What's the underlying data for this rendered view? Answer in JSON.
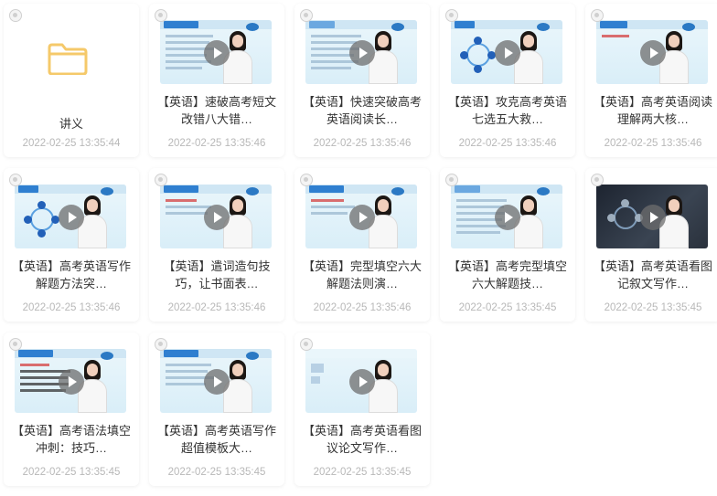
{
  "items": [
    {
      "title": "讲义",
      "date": "2022-02-25 13:35:44",
      "type": "folder"
    },
    {
      "title": "【英语】速破高考短文改错八大错…",
      "date": "2022-02-25 13:35:46",
      "type": "video"
    },
    {
      "title": "【英语】快速突破高考英语阅读长…",
      "date": "2022-02-25 13:35:46",
      "type": "video"
    },
    {
      "title": "【英语】攻克高考英语七选五大救…",
      "date": "2022-02-25 13:35:46",
      "type": "video"
    },
    {
      "title": "【英语】高考英语阅读理解两大核…",
      "date": "2022-02-25 13:35:46",
      "type": "video"
    },
    {
      "title": "【英语】高考英语写作解题方法突…",
      "date": "2022-02-25 13:35:46",
      "type": "video"
    },
    {
      "title": "【英语】遣词造句技巧，让书面表…",
      "date": "2022-02-25 13:35:46",
      "type": "video"
    },
    {
      "title": "【英语】完型填空六大解题法则演…",
      "date": "2022-02-25 13:35:46",
      "type": "video"
    },
    {
      "title": "【英语】高考完型填空六大解题技…",
      "date": "2022-02-25 13:35:45",
      "type": "video"
    },
    {
      "title": "【英语】高考英语看图记叙文写作…",
      "date": "2022-02-25 13:35:45",
      "type": "video"
    },
    {
      "title": "【英语】高考语法填空冲刺：技巧…",
      "date": "2022-02-25 13:35:45",
      "type": "video"
    },
    {
      "title": "【英语】高考英语写作超值模板大…",
      "date": "2022-02-25 13:35:45",
      "type": "video"
    },
    {
      "title": "【英语】高考英语看图议论文写作…",
      "date": "2022-02-25 13:35:45",
      "type": "video"
    }
  ],
  "colors": {
    "folder": "#f5c96a",
    "date": "#b8b8b8",
    "title": "#333333",
    "play": "#6e6e6e"
  },
  "icons": {
    "folder": "folder-icon",
    "play": "play-icon",
    "checkbox": "select-checkbox"
  }
}
